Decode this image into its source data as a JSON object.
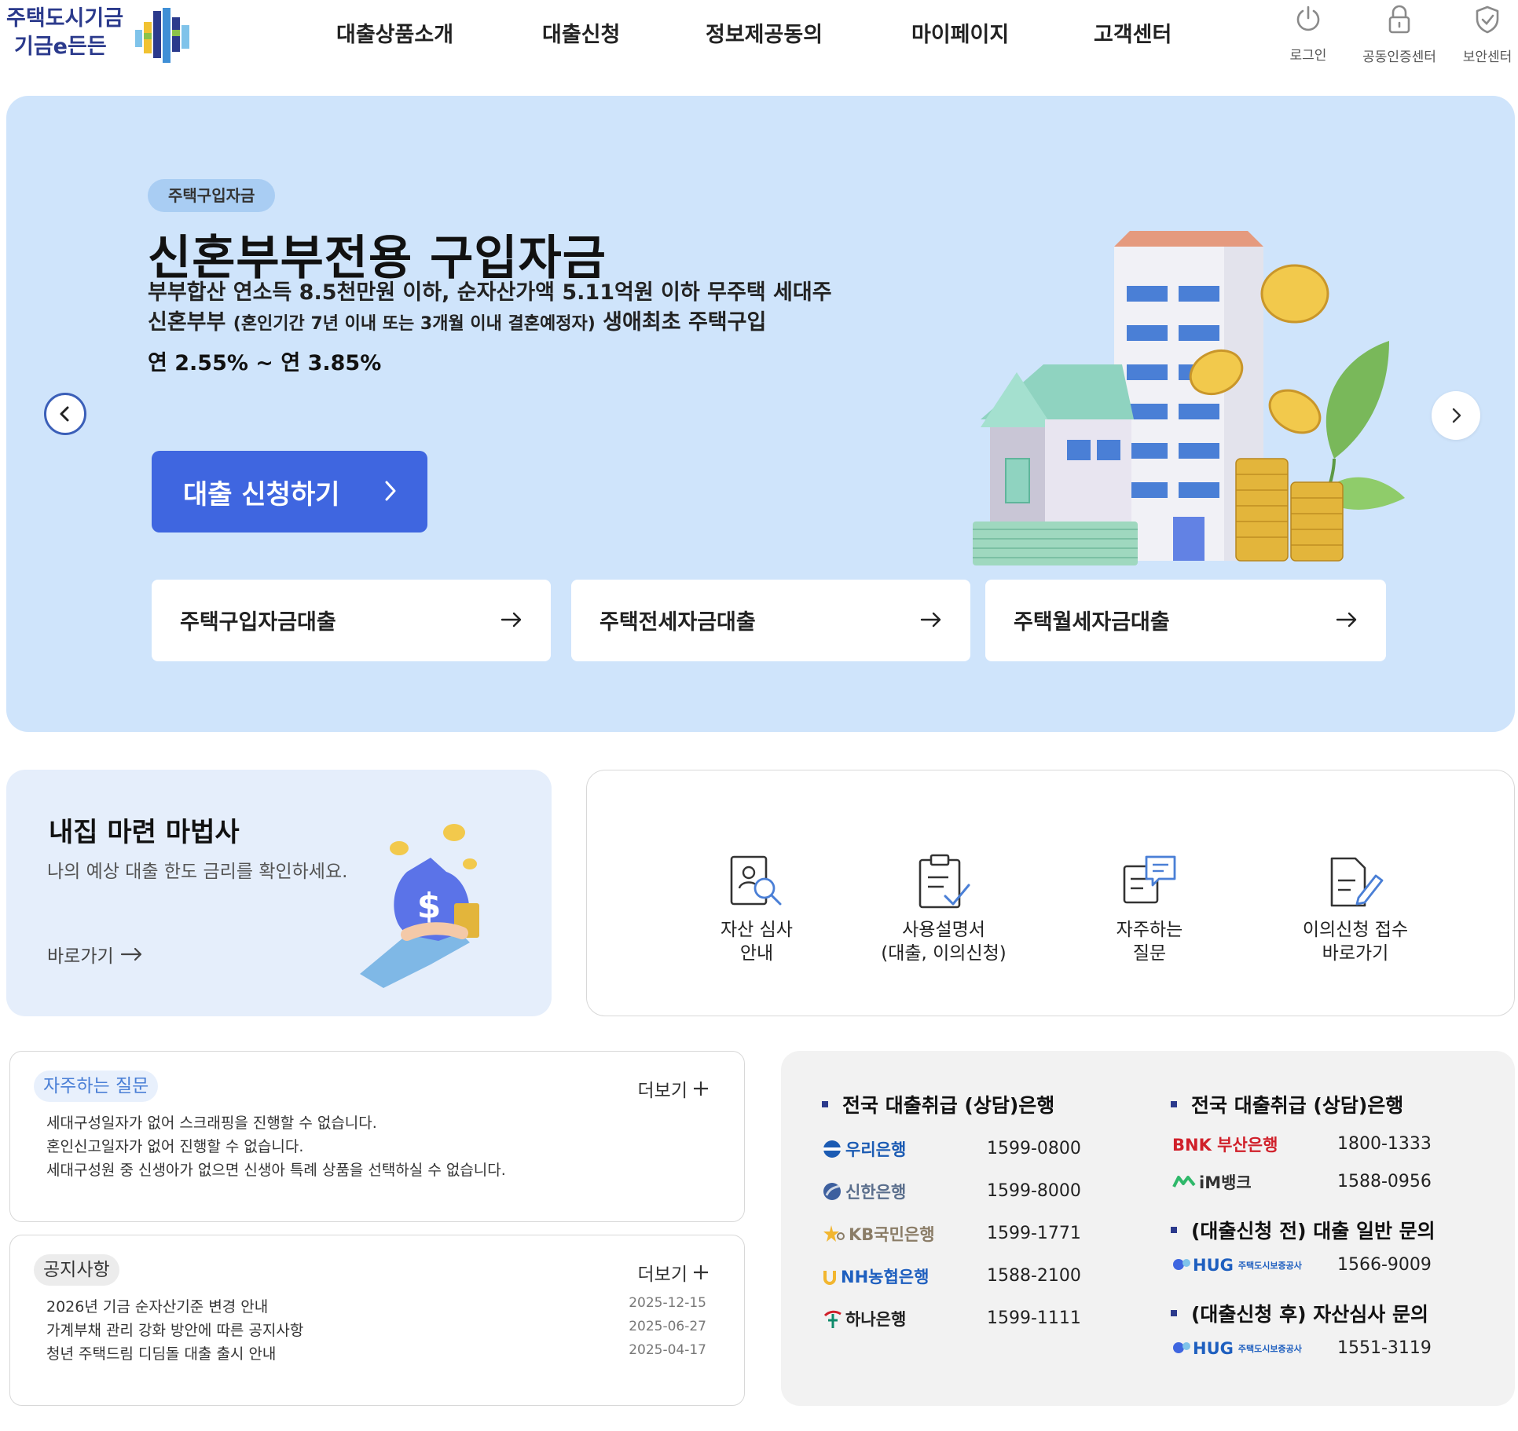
{
  "brand": {
    "logo_line1": "주택도시기금",
    "logo_line2": "기금e든든"
  },
  "nav": {
    "items": [
      "대출상품소개",
      "대출신청",
      "정보제공동의",
      "마이페이지",
      "고객센터"
    ]
  },
  "util": {
    "login": "로그인",
    "cert": "공동인증센터",
    "security": "보안센터"
  },
  "hero": {
    "badge": "주택구입자금",
    "title": "신혼부부전용 구입자금",
    "desc1": "부부합산 연소득 8.5천만원 이하, 순자산가액 5.11억원 이하 무주택 세대주",
    "desc2_a": "신혼부부 ",
    "desc2_b": "(혼인기간 7년 이내 또는 3개월 이내 결혼예정자)",
    "desc2_c": " 생애최초 주택구입",
    "rate": "연 2.55% ~ 연 3.85%",
    "cta": "대출 신청하기",
    "loan_cards": [
      "주택구입자금대출",
      "주택전세자금대출",
      "주택월세자금대출"
    ]
  },
  "wizard": {
    "title": "내집 마련 마법사",
    "desc": "나의 예상 대출 한도 금리를 확인하세요.",
    "link": "바로가기"
  },
  "quick": {
    "items": [
      {
        "line1": "자산 심사",
        "line2": "안내"
      },
      {
        "line1": "사용설명서",
        "line2": "(대출, 이의신청)"
      },
      {
        "line1": "자주하는",
        "line2": "질문"
      },
      {
        "line1": "이의신청 접수",
        "line2": "바로가기"
      }
    ]
  },
  "faq": {
    "tag": "자주하는 질문",
    "more": "더보기",
    "items": [
      "세대구성일자가 없어 스크래핑을 진행할 수 없습니다.",
      "혼인신고일자가 없어 진행할 수 없습니다.",
      "세대구성원 중 신생아가 없으면 신생아 특례 상품을 선택하실 수 없습니다."
    ]
  },
  "notice": {
    "tag": "공지사항",
    "more": "더보기",
    "items": [
      {
        "title": "2026년 기금 순자산기준 변경 안내",
        "date": "2025-12-15"
      },
      {
        "title": "가계부채 관리 강화 방안에 따른 공지사항",
        "date": "2025-06-27"
      },
      {
        "title": "청년 주택드림 디딤돌 대출 출시 안내",
        "date": "2025-04-17"
      }
    ]
  },
  "banks": {
    "left_title": "전국 대출취급 (상담)은행",
    "left": [
      {
        "name": "우리은행",
        "phone": "1599-0800",
        "color": "#1b5bb3",
        "icon": "woori-icon"
      },
      {
        "name": "신한은행",
        "phone": "1599-8000",
        "color": "#5b6f8d",
        "icon": "shinhan-icon"
      },
      {
        "name": "KB국민은행",
        "phone": "1599-1771",
        "color": "#8a7c66",
        "icon": "kb-icon"
      },
      {
        "name": "NH농협은행",
        "phone": "1588-2100",
        "color": "#1e5fbf",
        "icon": "nh-icon"
      },
      {
        "name": "하나은행",
        "phone": "1599-1111",
        "color": "#222222",
        "icon": "hana-icon"
      }
    ],
    "right_title1": "전국 대출취급 (상담)은행",
    "right": [
      {
        "name": "BNK 부산은행",
        "phone": "1800-1333",
        "color": "#d0202a",
        "icon": "bnk-icon"
      },
      {
        "name": "iM뱅크",
        "phone": "1588-0956",
        "color": "#333333",
        "icon": "im-icon"
      }
    ],
    "right_title2": "(대출신청 전) 대출 일반 문의",
    "hug1": {
      "name": "HUG",
      "sub": "주택도시보증공사",
      "phone": "1566-9009"
    },
    "right_title3": "(대출신청 후) 자산심사 문의",
    "hug2": {
      "name": "HUG",
      "sub": "주택도시보증공사",
      "phone": "1551-3119"
    }
  },
  "colors": {
    "brand_navy": "#2b3a8c",
    "hero_bg": "#cfe4fb",
    "cta_blue": "#3f66e0"
  }
}
